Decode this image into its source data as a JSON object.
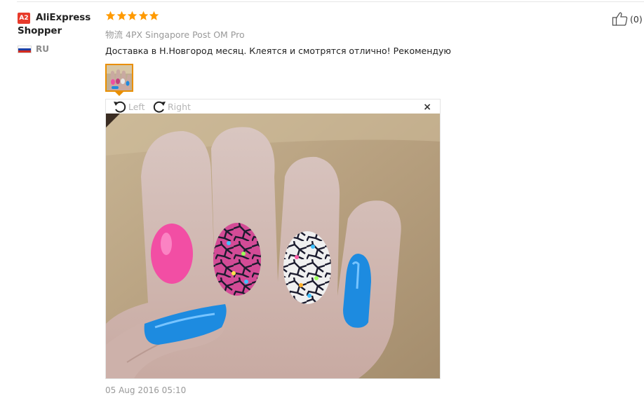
{
  "user": {
    "badge": "A2",
    "name": "AliExpress Shopper",
    "country": "RU",
    "flag_colors": [
      "#ffffff",
      "#1c3fa6",
      "#d52b1e"
    ]
  },
  "review": {
    "stars": 5,
    "star_color": "#ff9a00",
    "logistics_label": "物流",
    "logistics_value": "4PX Singapore Post OM Pro",
    "text": "Доставка в Н.Новгород месяц. Клеятся и смотрятся отлично! Рекомендую",
    "date": "05 Aug 2016 05:10"
  },
  "viewer": {
    "rotate_left": "Left",
    "rotate_right": "Right",
    "close": "×"
  },
  "helpful": {
    "count": "(0)",
    "icon": "thumbs-up-icon"
  },
  "colors": {
    "accent": "#e98f00",
    "badge": "#e83b2b"
  }
}
